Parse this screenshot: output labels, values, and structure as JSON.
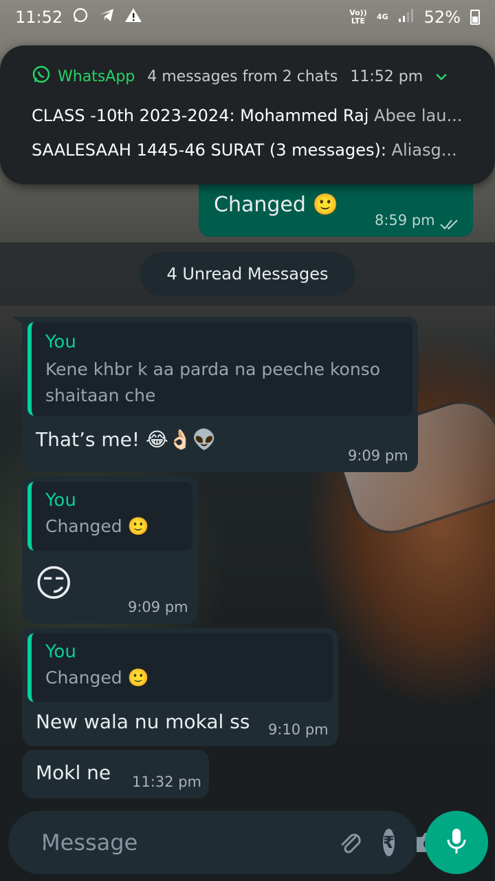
{
  "status_bar": {
    "time": "11:52",
    "battery": "52%",
    "network": "4G",
    "volte": "Vo)) LTE"
  },
  "notification": {
    "app_name": "WhatsApp",
    "summary": "4 messages from 2 chats",
    "time": "11:52 pm",
    "lines": [
      {
        "sender": "CLASS -10th 2023-2024: Mohammed Raj",
        "message": "Abee lau..."
      },
      {
        "sender": "SAALESAAH 1445-46 SURAT (3 messages):",
        "message": "Aliasg..."
      }
    ]
  },
  "messages": {
    "m0": {
      "text": "Changed 🙂",
      "time": "8:59 pm",
      "status": "read"
    },
    "unread_label": "4 Unread Messages",
    "m1": {
      "quote_name": "You",
      "quote_text": "Kene khbr k aa parda na peeche konso shaitaan che",
      "text": "That’s me! 😂👌🏻👽",
      "time": "9:09 pm"
    },
    "m2": {
      "quote_name": "You",
      "quote_text": "Changed 🙂",
      "text": "😏",
      "time": "9:09 pm"
    },
    "m3": {
      "quote_name": "You",
      "quote_text": "Changed 🙂",
      "text": "New wala nu mokal ss",
      "time": "9:10 pm"
    },
    "m4": {
      "text": "Mokl ne",
      "time": "11:32 pm"
    }
  },
  "composer": {
    "placeholder": "Message"
  },
  "colors": {
    "accent": "#00a884",
    "outgoing_bubble": "#005c4b",
    "incoming_bubble": "#202c33",
    "quote_bar": "#06cf9c"
  }
}
